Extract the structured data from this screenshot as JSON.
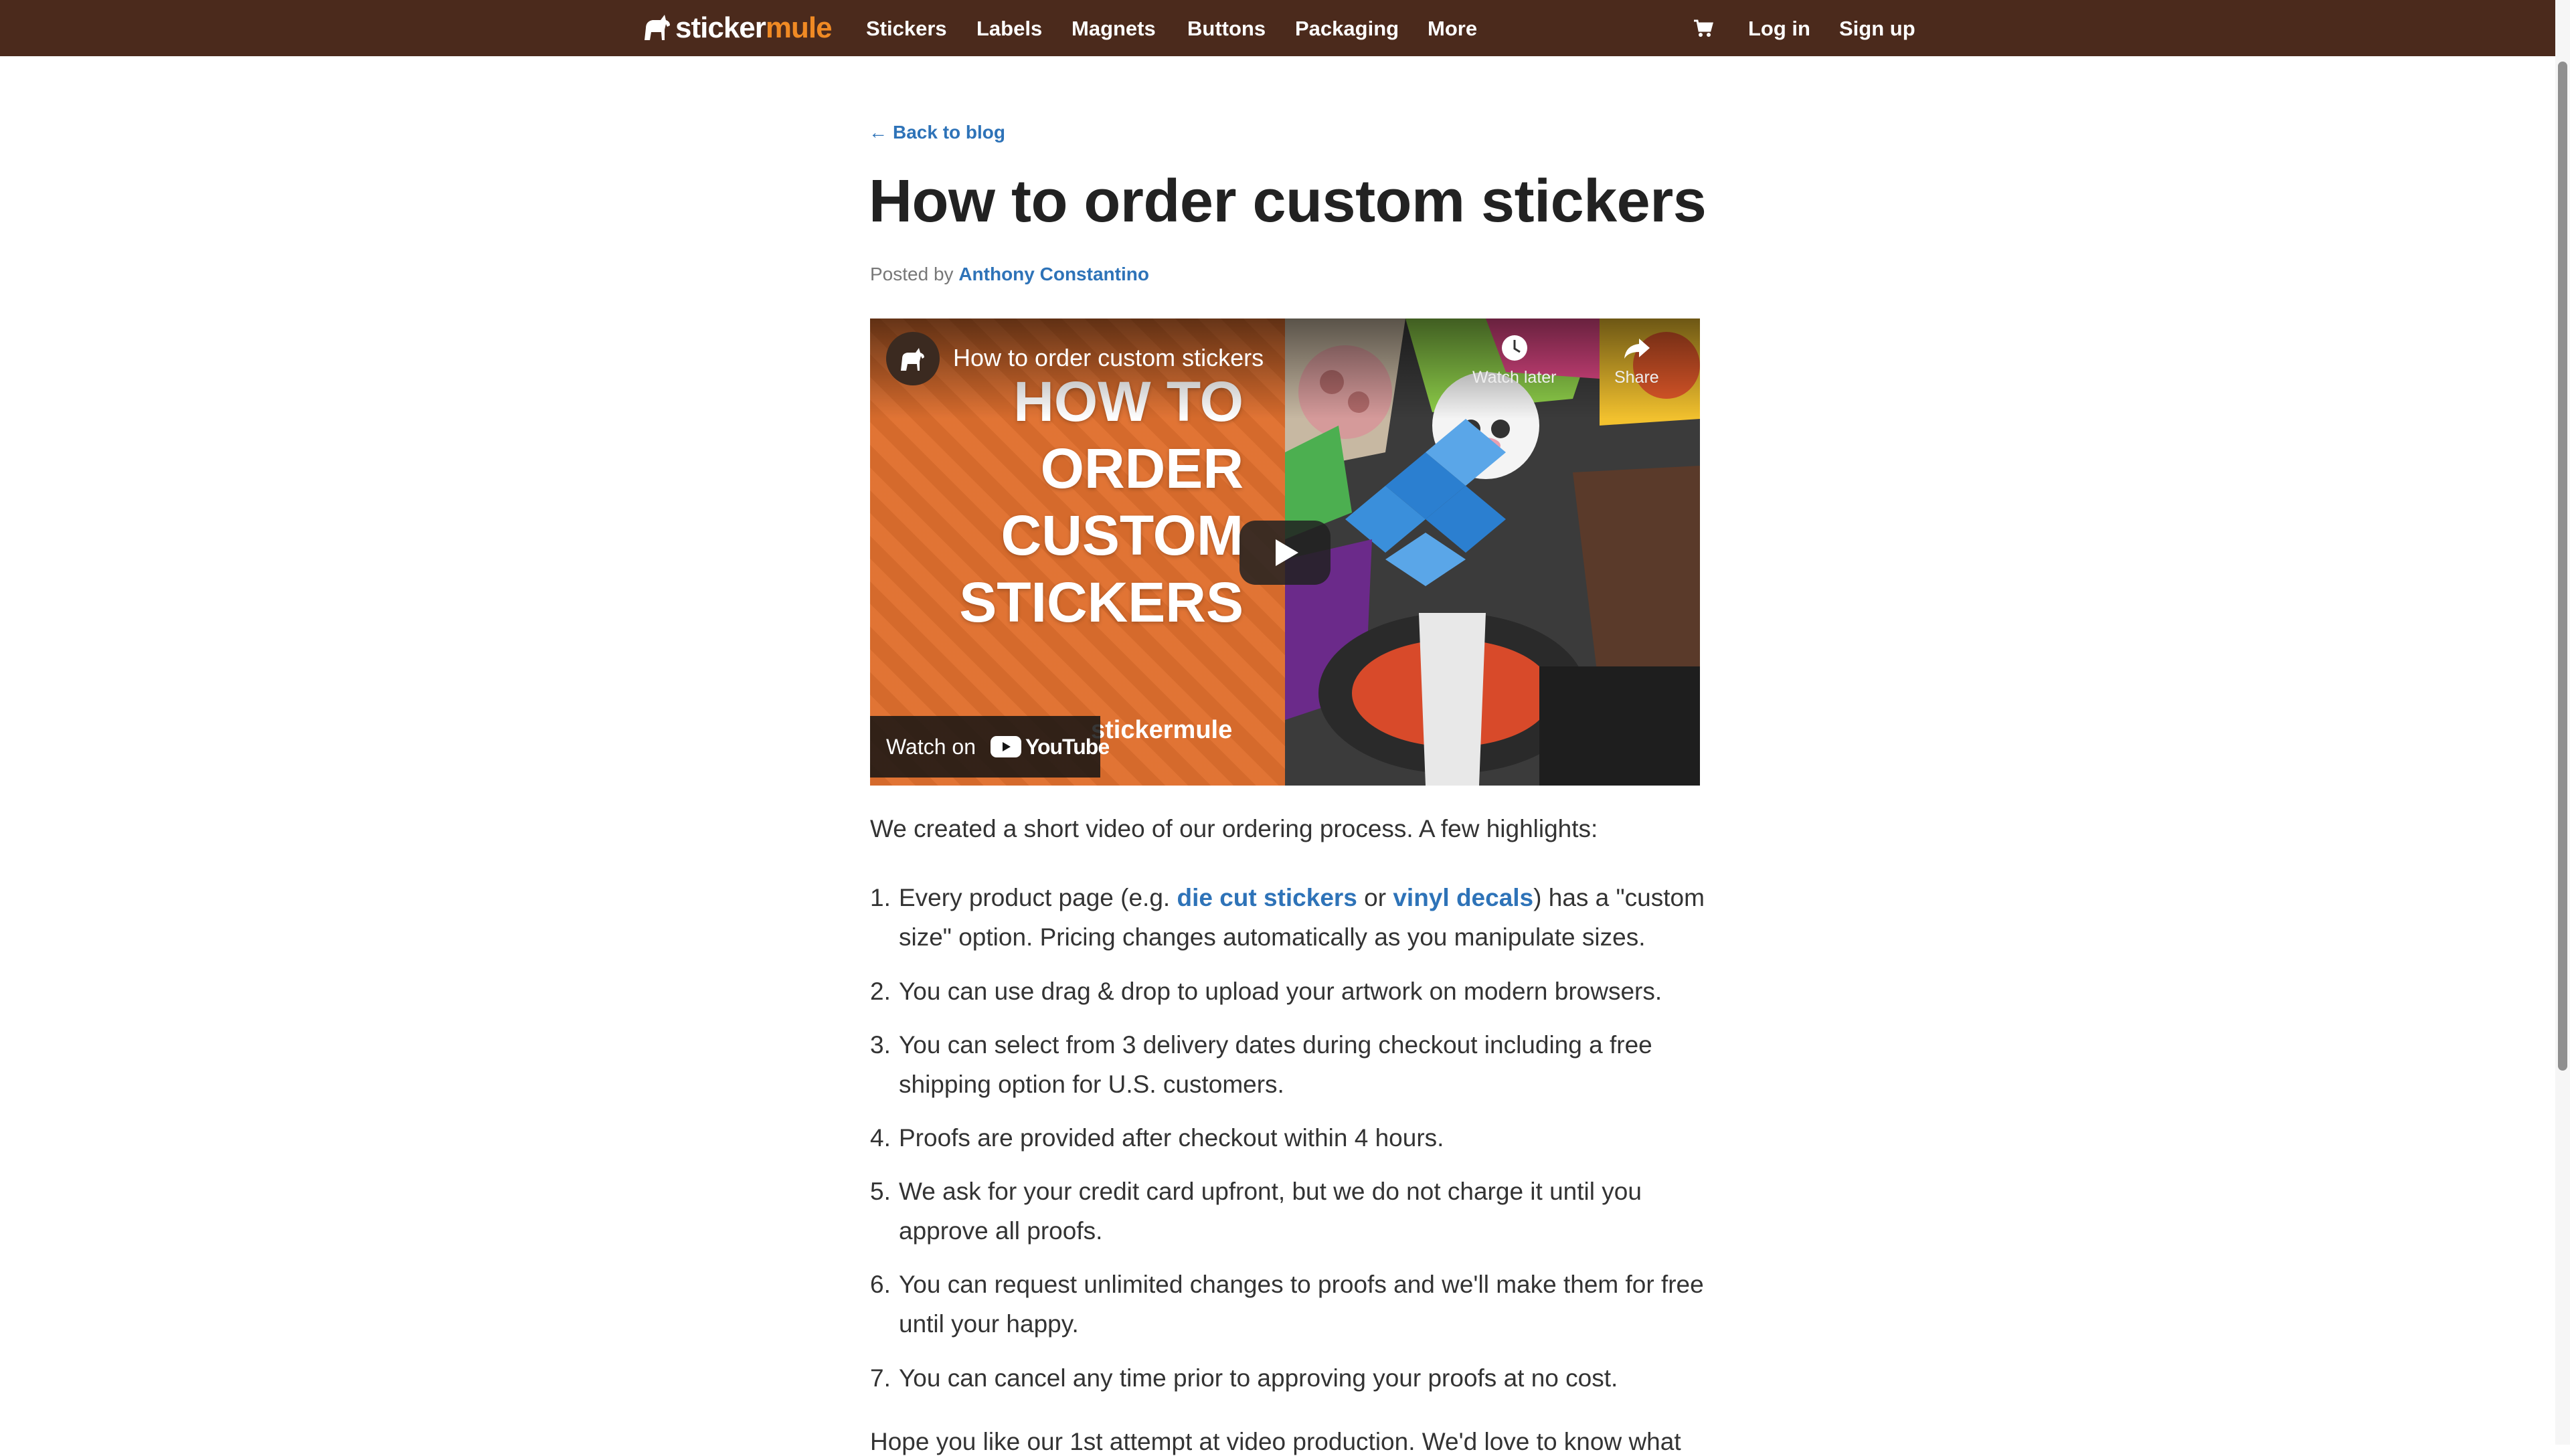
{
  "nav": {
    "logo_part1": "sticker",
    "logo_part2": "mule",
    "items": [
      "Stickers",
      "Labels",
      "Magnets",
      "Buttons",
      "Packaging",
      "More"
    ],
    "cart_icon": "cart-icon",
    "login": "Log in",
    "signup": "Sign up"
  },
  "article": {
    "back_arrow": "←",
    "back_label": "Back to blog",
    "title": "How to order custom stickers",
    "posted_by": "Posted by",
    "author": "Anthony Constantino"
  },
  "video": {
    "title": "How to order custom stickers",
    "thumb_lines": [
      "HOW TO",
      "ORDER",
      "CUSTOM",
      "STICKERS"
    ],
    "thumb_brand": "stickermule",
    "watch_later": "Watch later",
    "share": "Share",
    "watch_on": "Watch on",
    "youtube": "YouTube"
  },
  "body": {
    "intro": "We created a short video of our ordering process. A few highlights:",
    "items": [
      {
        "num": "1.",
        "pre": "Every product page (e.g. ",
        "link1": "die cut stickers",
        "mid": " or ",
        "link2": "vinyl decals",
        "post": ") has a \"custom",
        "line2": "size\" option. Pricing changes automatically as you manipulate sizes."
      },
      {
        "num": "2.",
        "line1": "You can use drag & drop to upload your artwork on modern browsers."
      },
      {
        "num": "3.",
        "line1": "You can select from 3 delivery dates during checkout including a free",
        "line2": "shipping option for U.S. customers."
      },
      {
        "num": "4.",
        "line1": "Proofs are provided after checkout within 4 hours."
      },
      {
        "num": "5.",
        "line1": "We ask for your credit card upfront, but we do not charge it until you",
        "line2": "approve all proofs."
      },
      {
        "num": "6.",
        "line1": "You can request unlimited changes to proofs and we'll make them for free",
        "line2": "until your happy."
      },
      {
        "num": "7.",
        "line1": "You can cancel any time prior to approving your proofs at no cost."
      }
    ],
    "closing": "Hope you like our 1st attempt at video production. We'd love to know what"
  },
  "colors": {
    "nav_bg": "#4b2a1c",
    "link": "#2e73b8",
    "brand_orange": "#f08a24",
    "thumb_orange": "#e0702e"
  }
}
